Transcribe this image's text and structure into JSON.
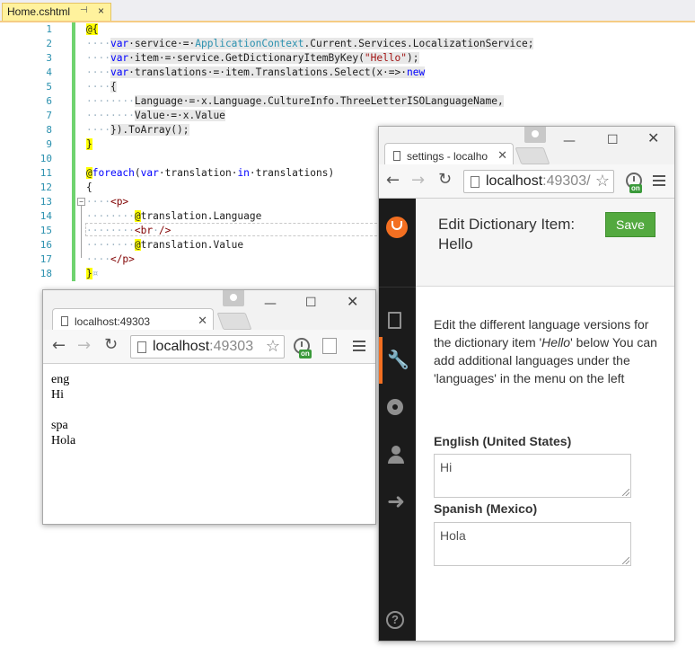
{
  "editor": {
    "tab_label": "Home.cshtml",
    "line_numbers": [
      "1",
      "2",
      "3",
      "4",
      "5",
      "6",
      "7",
      "8",
      "9",
      "10",
      "11",
      "12",
      "13",
      "14",
      "15",
      "16",
      "17",
      "18"
    ],
    "code": {
      "l1_open": "@{",
      "l2_ws": "····",
      "l2_kw": "var",
      "l2_a": "·service·=·",
      "l2_ty": "ApplicationContext",
      "l2_b": ".Current.Services.LocalizationService;",
      "l3_ws": "····",
      "l3_kw": "var",
      "l3_a": "·item·=·service.GetDictionaryItemByKey(",
      "l3_str": "\"Hello\"",
      "l3_b": ");",
      "l4_ws": "····",
      "l4_kw": "var",
      "l4_a": "·translations·=·item.Translations.Select(x·=>·",
      "l4_kw2": "new",
      "l5_ws": "····",
      "l5_a": "{",
      "l6_ws": "········",
      "l6_a": "Language·=·x.Language.CultureInfo.ThreeLetterISOLanguageName,",
      "l7_ws": "········",
      "l7_a": "Value·=·x.Value",
      "l8_ws": "····",
      "l8_a": "}).ToArray();",
      "l9_close": "}",
      "l11_at": "@",
      "l11_kw": "foreach",
      "l11_a": "(",
      "l11_kw2": "var",
      "l11_b": "·translation·",
      "l11_kw3": "in",
      "l11_c": "·translations)",
      "l12_a": "{",
      "l13_ws": "····",
      "l13_tag": "<p>",
      "l14_ws": "········",
      "l14_at": "@",
      "l14_a": "translation.Language",
      "l15_ws": "········",
      "l15_tag": "<br",
      "l15_tag2": "/>",
      "l16_ws": "········",
      "l16_at": "@",
      "l16_a": "translation.Value",
      "l17_ws": "····",
      "l17_tag": "</p>",
      "l18_close": "}",
      "l18_ws": "¤"
    }
  },
  "small_browser": {
    "tab_title": "localhost:49303",
    "url_host": "localhost",
    "url_port": ":49303",
    "ext_badge": "on",
    "entries": [
      {
        "lang": "eng",
        "value": "Hi"
      },
      {
        "lang": "spa",
        "value": "Hola"
      }
    ]
  },
  "large_browser": {
    "tab_title": "settings - localho",
    "url_host": "localhost",
    "url_port": ":49303/",
    "ext_badge": "on",
    "header_title_line1": "Edit Dictionary Item:",
    "header_title_line2": "Hello",
    "save_label": "Save",
    "description_pre": "Edit the different language versions for the dictionary item '",
    "description_key": "Hello",
    "description_post": "' below You can add additional languages under the 'languages' in the menu on the left",
    "fields": [
      {
        "label": "English (United States)",
        "value": "Hi"
      },
      {
        "label": "Spanish (Mexico)",
        "value": "Hola"
      }
    ],
    "help_glyph": "?"
  },
  "colors": {
    "accent_orange": "#f36f21",
    "save_green": "#53a93f",
    "sidebar_dark": "#1b1b1b",
    "change_bar_green": "#6fd36f"
  },
  "icons": [
    "page-icon",
    "star-icon",
    "menu-icon",
    "back-arrow-icon",
    "forward-arrow-icon",
    "reload-icon",
    "document-icon",
    "wrench-icon",
    "gear-icon",
    "user-icon",
    "arrow-right-icon",
    "help-icon",
    "umbraco-logo-icon",
    "close-icon",
    "minimize-icon",
    "maximize-icon"
  ]
}
